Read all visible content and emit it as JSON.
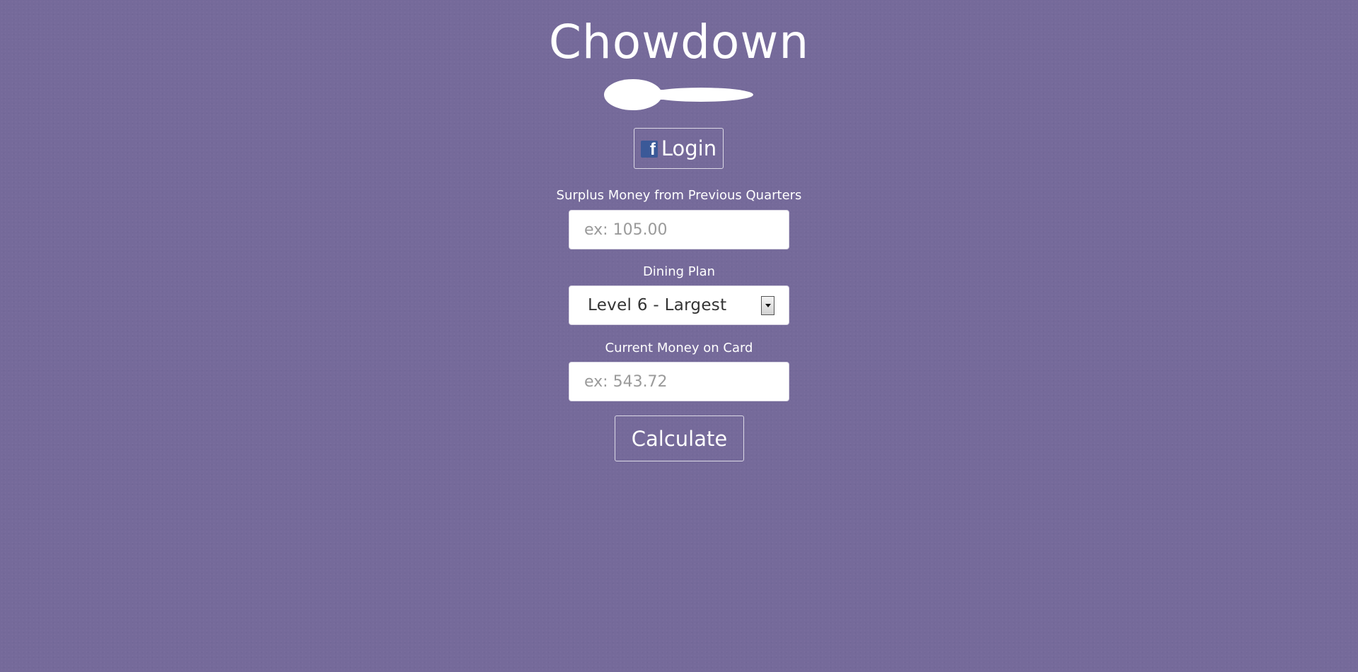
{
  "app": {
    "title": "Chowdown",
    "logo_icon": "spoon-icon"
  },
  "login": {
    "icon": "facebook-icon",
    "icon_letter": "f",
    "label": "Login"
  },
  "form": {
    "surplus": {
      "label": "Surplus Money from Previous Quarters",
      "placeholder": "ex: 105.00",
      "value": ""
    },
    "dining_plan": {
      "label": "Dining Plan",
      "selected": "Level 6 - Largest",
      "icon": "dropdown-arrow-icon"
    },
    "current_money": {
      "label": "Current Money on Card",
      "placeholder": "ex: 543.72",
      "value": ""
    },
    "calculate_label": "Calculate"
  },
  "colors": {
    "background": "#756a9a",
    "text": "#ffffff",
    "facebook": "#3b5998"
  }
}
